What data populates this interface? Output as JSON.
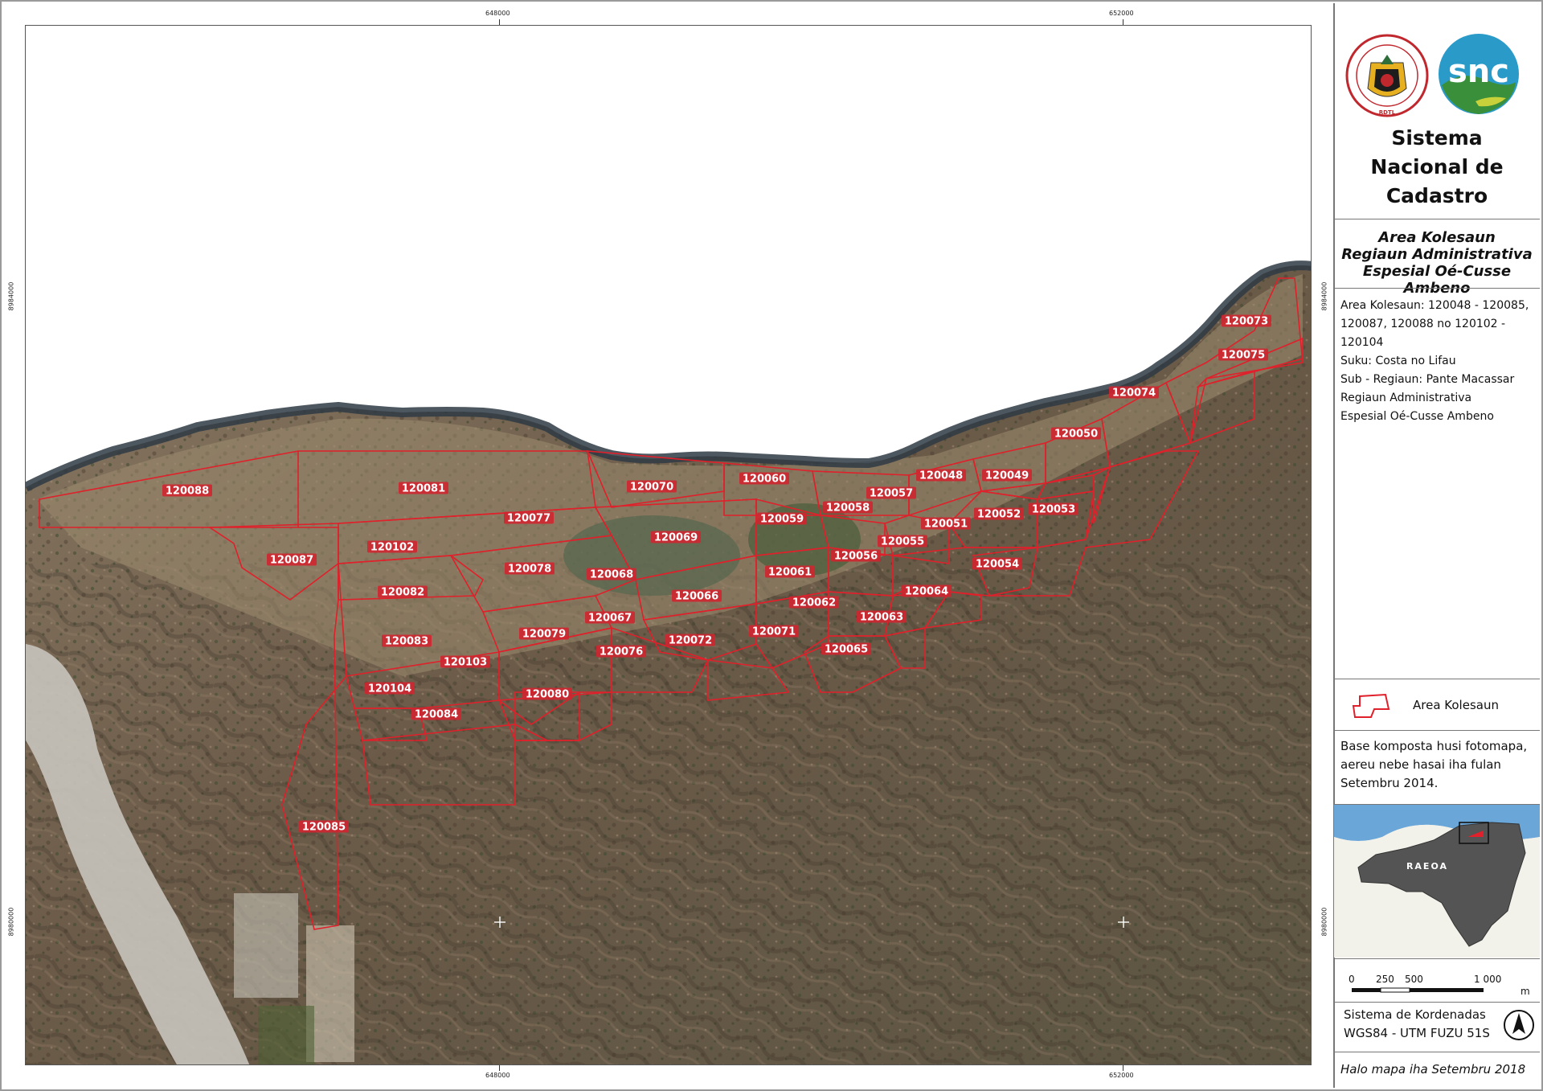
{
  "map": {
    "top_coords": [
      "648000",
      "652000"
    ],
    "bottom_coords": [
      "648000",
      "652000"
    ],
    "left_coords": [
      "8984000",
      "8980000"
    ],
    "right_coords": [
      "8984000",
      "8980000"
    ],
    "colors": {
      "boundary": "#e0202a",
      "label_bg": "#d3232f",
      "sea": "#ffffff",
      "land": "#6a5a4a"
    },
    "area_labels": [
      "120048",
      "120049",
      "120050",
      "120051",
      "120052",
      "120053",
      "120054",
      "120055",
      "120056",
      "120057",
      "120058",
      "120059",
      "120060",
      "120061",
      "120062",
      "120063",
      "120064",
      "120065",
      "120066",
      "120067",
      "120068",
      "120069",
      "120070",
      "120071",
      "120072",
      "120073",
      "120074",
      "120075",
      "120076",
      "120077",
      "120078",
      "120079",
      "120080",
      "120081",
      "120082",
      "120083",
      "120084",
      "120085",
      "120087",
      "120088",
      "120102",
      "120103",
      "120104"
    ]
  },
  "panel": {
    "logo_left": {
      "icon": "government-seal-icon",
      "ring_text": "REPUBLICA DEMOCRATICA DE TIMOR-LESTE",
      "bottom_text": "RDTL"
    },
    "logo_right": {
      "icon": "snc-logo-icon",
      "text": "snc"
    },
    "org_title": "Sistema Nacional de Cadastro",
    "map_title": [
      "Area Kolesaun",
      "Regiaun Administrativa",
      "Espesial Oé-Cusse Ambeno"
    ],
    "info_lines": [
      "Area Kolesaun: 120048 - 120085,",
      "120087, 120088 no 120102 - 120104",
      "Suku: Costa no Lifau",
      "Sub - Regiaun: Pante Macassar",
      "Regiaun Administrativa",
      "Espesial Oé-Cusse Ambeno"
    ],
    "legend_label": "Area Kolesaun",
    "base_note": [
      "Base komposta husi fotomapa,",
      "aereu nebe hasai iha fulan",
      "Setembru 2014."
    ],
    "inset_label": "RAEOA",
    "scale": {
      "ticks": [
        "0",
        "250",
        "500",
        "1 000"
      ],
      "unit": "m"
    },
    "crs": [
      "Sistema de Kordenadas",
      "WGS84 - UTM FUZU 51S"
    ],
    "made_date": "Halo mapa iha Setembru 2018"
  }
}
